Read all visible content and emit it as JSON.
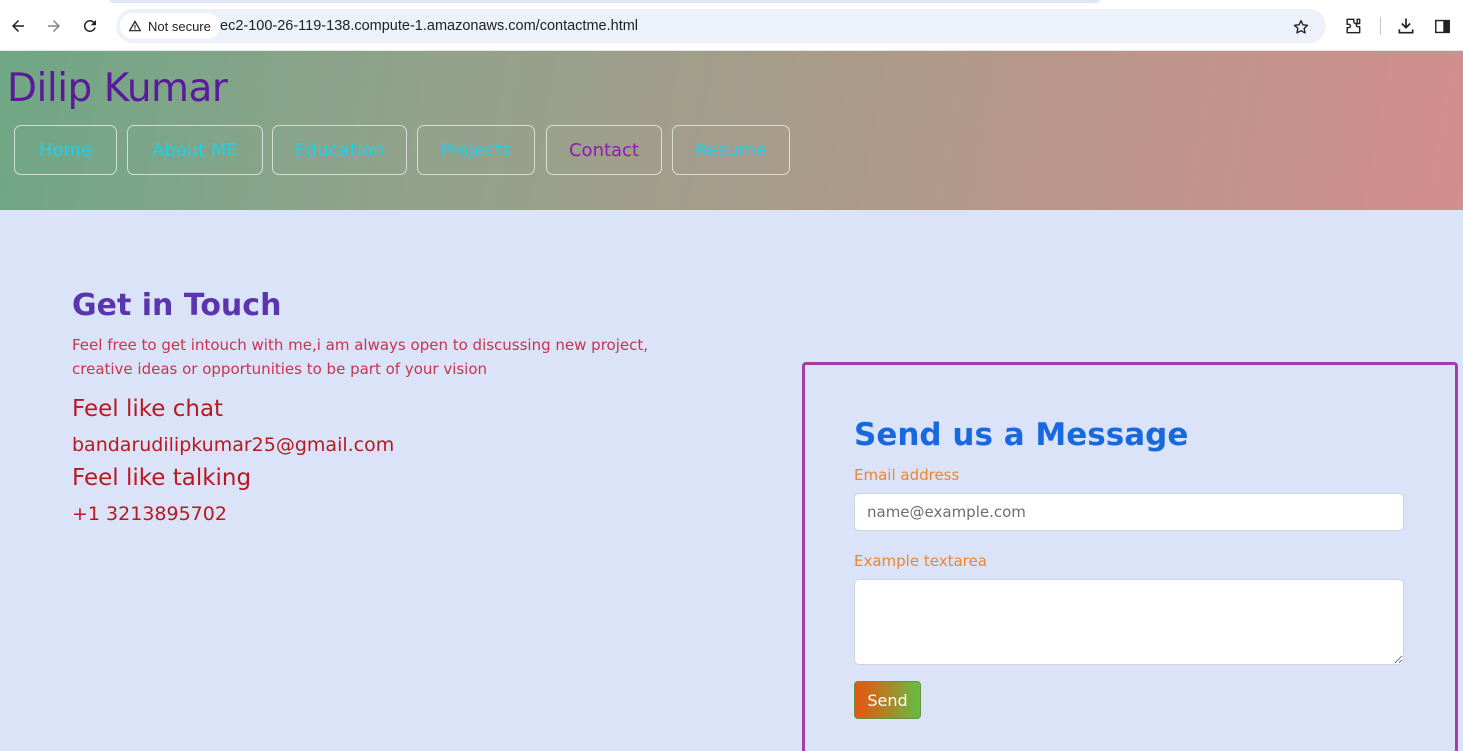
{
  "browser": {
    "security_label": "Not secure",
    "url": "ec2-100-26-119-138.compute-1.amazonaws.com/contactme.html",
    "icons": [
      "back-icon",
      "forward-icon",
      "reload-icon",
      "warning-icon",
      "star-icon",
      "extensions-icon",
      "download-icon",
      "side-panel-icon"
    ]
  },
  "header": {
    "site_title": "Dilip Kumar",
    "nav": [
      {
        "label": "Home"
      },
      {
        "label": "About ME"
      },
      {
        "label": "Education"
      },
      {
        "label": "Projects"
      },
      {
        "label": "Contact",
        "active": true
      },
      {
        "label": "Resume"
      }
    ]
  },
  "contact": {
    "title": "Get in Touch",
    "description_line1": "Feel free to get intouch with me,i am always open to discussing new project,",
    "description_line2": "creative ideas or opportunities to be part of your vision",
    "chat_heading": "Feel like chat",
    "email": "bandarudilipkumar25@gmail.com",
    "talk_heading": "Feel like talking",
    "phone": "+1 3213895702"
  },
  "form": {
    "title": "Send us a Message",
    "email_label": "Email address",
    "email_placeholder": "name@example.com",
    "textarea_label": "Example textarea",
    "submit_label": "Send"
  },
  "colors": {
    "page_bg": "#dae3f7",
    "site_title": "#5b1a9c",
    "nav_text": "#1bd1ef",
    "nav_active": "#8e1bb2",
    "touch_title": "#5a35ad",
    "info_text": "#b91822",
    "form_border": "#a33ea8",
    "form_title": "#1869e0",
    "form_label": "#f0852d"
  }
}
